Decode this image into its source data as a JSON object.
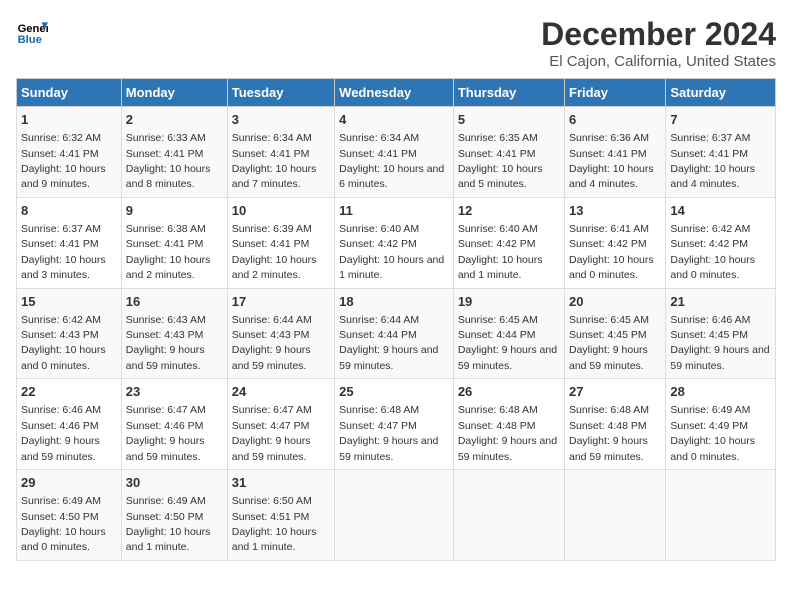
{
  "header": {
    "logo_line1": "General",
    "logo_line2": "Blue",
    "title": "December 2024",
    "subtitle": "El Cajon, California, United States"
  },
  "columns": [
    "Sunday",
    "Monday",
    "Tuesday",
    "Wednesday",
    "Thursday",
    "Friday",
    "Saturday"
  ],
  "weeks": [
    [
      {
        "day": "1",
        "sunrise": "Sunrise: 6:32 AM",
        "sunset": "Sunset: 4:41 PM",
        "daylight": "Daylight: 10 hours and 9 minutes."
      },
      {
        "day": "2",
        "sunrise": "Sunrise: 6:33 AM",
        "sunset": "Sunset: 4:41 PM",
        "daylight": "Daylight: 10 hours and 8 minutes."
      },
      {
        "day": "3",
        "sunrise": "Sunrise: 6:34 AM",
        "sunset": "Sunset: 4:41 PM",
        "daylight": "Daylight: 10 hours and 7 minutes."
      },
      {
        "day": "4",
        "sunrise": "Sunrise: 6:34 AM",
        "sunset": "Sunset: 4:41 PM",
        "daylight": "Daylight: 10 hours and 6 minutes."
      },
      {
        "day": "5",
        "sunrise": "Sunrise: 6:35 AM",
        "sunset": "Sunset: 4:41 PM",
        "daylight": "Daylight: 10 hours and 5 minutes."
      },
      {
        "day": "6",
        "sunrise": "Sunrise: 6:36 AM",
        "sunset": "Sunset: 4:41 PM",
        "daylight": "Daylight: 10 hours and 4 minutes."
      },
      {
        "day": "7",
        "sunrise": "Sunrise: 6:37 AM",
        "sunset": "Sunset: 4:41 PM",
        "daylight": "Daylight: 10 hours and 4 minutes."
      }
    ],
    [
      {
        "day": "8",
        "sunrise": "Sunrise: 6:37 AM",
        "sunset": "Sunset: 4:41 PM",
        "daylight": "Daylight: 10 hours and 3 minutes."
      },
      {
        "day": "9",
        "sunrise": "Sunrise: 6:38 AM",
        "sunset": "Sunset: 4:41 PM",
        "daylight": "Daylight: 10 hours and 2 minutes."
      },
      {
        "day": "10",
        "sunrise": "Sunrise: 6:39 AM",
        "sunset": "Sunset: 4:41 PM",
        "daylight": "Daylight: 10 hours and 2 minutes."
      },
      {
        "day": "11",
        "sunrise": "Sunrise: 6:40 AM",
        "sunset": "Sunset: 4:42 PM",
        "daylight": "Daylight: 10 hours and 1 minute."
      },
      {
        "day": "12",
        "sunrise": "Sunrise: 6:40 AM",
        "sunset": "Sunset: 4:42 PM",
        "daylight": "Daylight: 10 hours and 1 minute."
      },
      {
        "day": "13",
        "sunrise": "Sunrise: 6:41 AM",
        "sunset": "Sunset: 4:42 PM",
        "daylight": "Daylight: 10 hours and 0 minutes."
      },
      {
        "day": "14",
        "sunrise": "Sunrise: 6:42 AM",
        "sunset": "Sunset: 4:42 PM",
        "daylight": "Daylight: 10 hours and 0 minutes."
      }
    ],
    [
      {
        "day": "15",
        "sunrise": "Sunrise: 6:42 AM",
        "sunset": "Sunset: 4:43 PM",
        "daylight": "Daylight: 10 hours and 0 minutes."
      },
      {
        "day": "16",
        "sunrise": "Sunrise: 6:43 AM",
        "sunset": "Sunset: 4:43 PM",
        "daylight": "Daylight: 9 hours and 59 minutes."
      },
      {
        "day": "17",
        "sunrise": "Sunrise: 6:44 AM",
        "sunset": "Sunset: 4:43 PM",
        "daylight": "Daylight: 9 hours and 59 minutes."
      },
      {
        "day": "18",
        "sunrise": "Sunrise: 6:44 AM",
        "sunset": "Sunset: 4:44 PM",
        "daylight": "Daylight: 9 hours and 59 minutes."
      },
      {
        "day": "19",
        "sunrise": "Sunrise: 6:45 AM",
        "sunset": "Sunset: 4:44 PM",
        "daylight": "Daylight: 9 hours and 59 minutes."
      },
      {
        "day": "20",
        "sunrise": "Sunrise: 6:45 AM",
        "sunset": "Sunset: 4:45 PM",
        "daylight": "Daylight: 9 hours and 59 minutes."
      },
      {
        "day": "21",
        "sunrise": "Sunrise: 6:46 AM",
        "sunset": "Sunset: 4:45 PM",
        "daylight": "Daylight: 9 hours and 59 minutes."
      }
    ],
    [
      {
        "day": "22",
        "sunrise": "Sunrise: 6:46 AM",
        "sunset": "Sunset: 4:46 PM",
        "daylight": "Daylight: 9 hours and 59 minutes."
      },
      {
        "day": "23",
        "sunrise": "Sunrise: 6:47 AM",
        "sunset": "Sunset: 4:46 PM",
        "daylight": "Daylight: 9 hours and 59 minutes."
      },
      {
        "day": "24",
        "sunrise": "Sunrise: 6:47 AM",
        "sunset": "Sunset: 4:47 PM",
        "daylight": "Daylight: 9 hours and 59 minutes."
      },
      {
        "day": "25",
        "sunrise": "Sunrise: 6:48 AM",
        "sunset": "Sunset: 4:47 PM",
        "daylight": "Daylight: 9 hours and 59 minutes."
      },
      {
        "day": "26",
        "sunrise": "Sunrise: 6:48 AM",
        "sunset": "Sunset: 4:48 PM",
        "daylight": "Daylight: 9 hours and 59 minutes."
      },
      {
        "day": "27",
        "sunrise": "Sunrise: 6:48 AM",
        "sunset": "Sunset: 4:48 PM",
        "daylight": "Daylight: 9 hours and 59 minutes."
      },
      {
        "day": "28",
        "sunrise": "Sunrise: 6:49 AM",
        "sunset": "Sunset: 4:49 PM",
        "daylight": "Daylight: 10 hours and 0 minutes."
      }
    ],
    [
      {
        "day": "29",
        "sunrise": "Sunrise: 6:49 AM",
        "sunset": "Sunset: 4:50 PM",
        "daylight": "Daylight: 10 hours and 0 minutes."
      },
      {
        "day": "30",
        "sunrise": "Sunrise: 6:49 AM",
        "sunset": "Sunset: 4:50 PM",
        "daylight": "Daylight: 10 hours and 1 minute."
      },
      {
        "day": "31",
        "sunrise": "Sunrise: 6:50 AM",
        "sunset": "Sunset: 4:51 PM",
        "daylight": "Daylight: 10 hours and 1 minute."
      },
      {
        "day": "",
        "sunrise": "",
        "sunset": "",
        "daylight": ""
      },
      {
        "day": "",
        "sunrise": "",
        "sunset": "",
        "daylight": ""
      },
      {
        "day": "",
        "sunrise": "",
        "sunset": "",
        "daylight": ""
      },
      {
        "day": "",
        "sunrise": "",
        "sunset": "",
        "daylight": ""
      }
    ]
  ]
}
